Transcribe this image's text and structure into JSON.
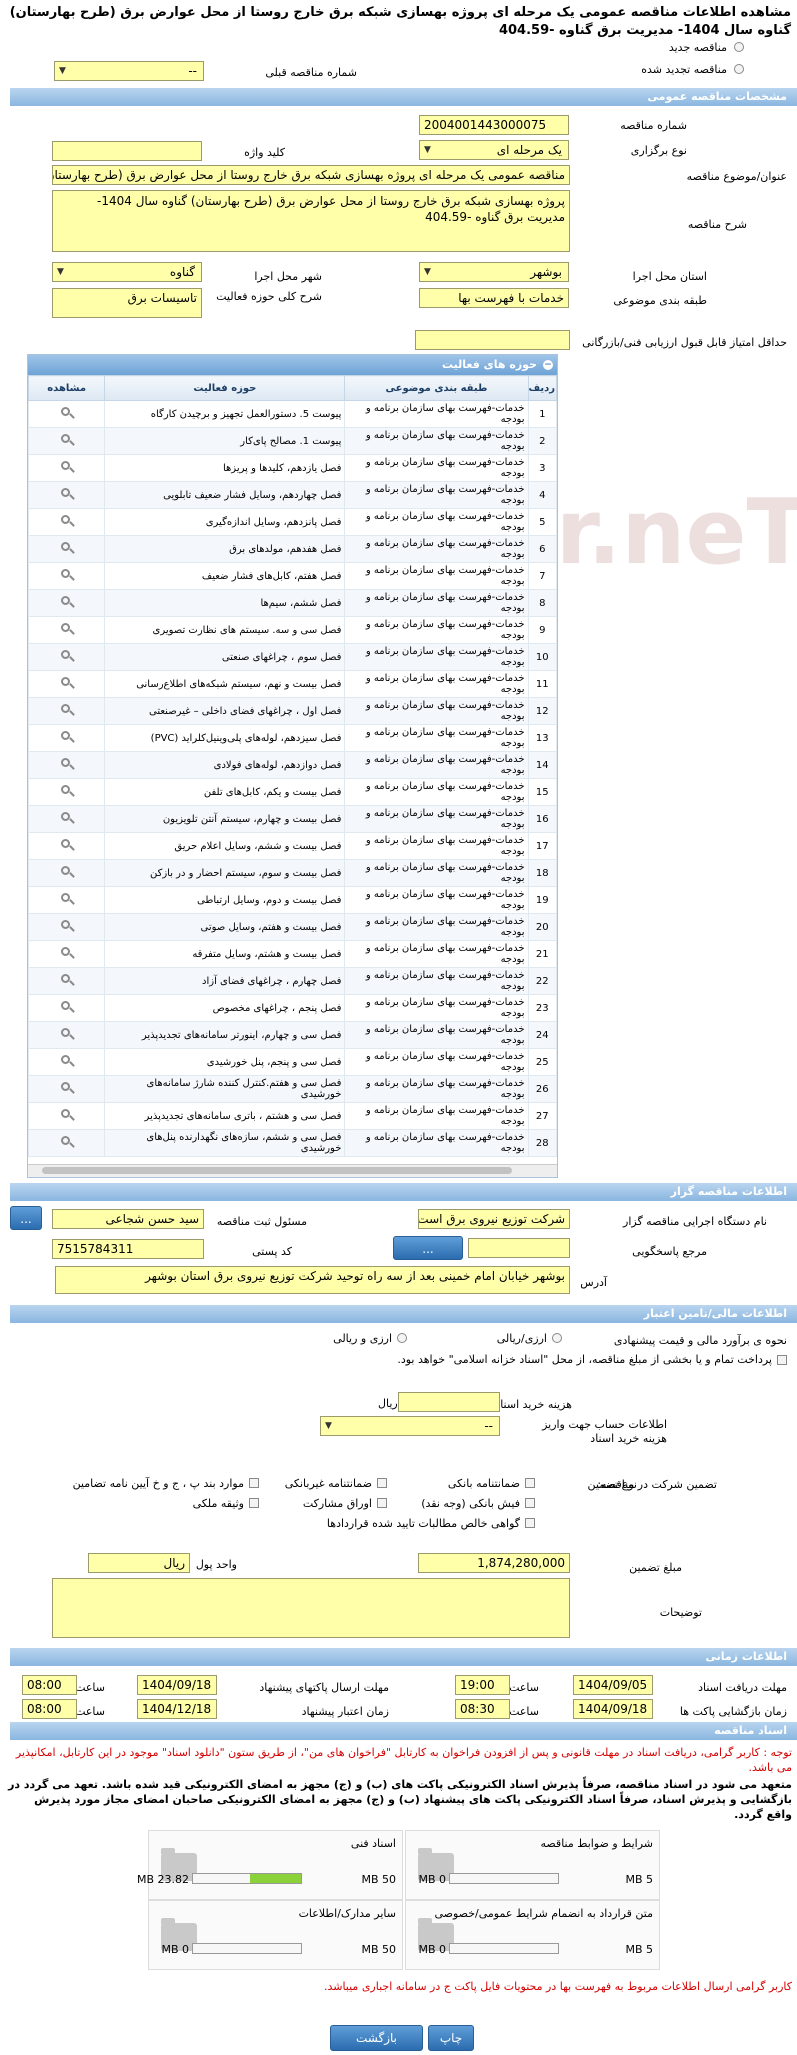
{
  "title": "مشاهده اطلاعات مناقصه عمومی یک مرحله ای پروژه بهسازی شبکه برق خارج روستا از محل عوارض برق (طرح بهارستان) گناوه سال 1404- مدیریت برق گناوه -404.59",
  "top": {
    "radio_new": "مناقصه جدید",
    "radio_renew": "مناقصه تجدید شده",
    "prev_number_label": "شماره مناقصه قبلی",
    "prev_number_value": "--"
  },
  "sections": {
    "general": "مشخصات مناقصه عمومی",
    "organizer": "اطلاعات مناقصه گزار",
    "financial": "اطلاعات مالی/تامین اعتبار",
    "timing": "اطلاعات زمانی",
    "documents": "اسناد مناقصه"
  },
  "general": {
    "number_label": "شماره مناقصه",
    "number_value": "2004001443000075",
    "type_label": "نوع برگزاری",
    "type_value": "یک مرحله ای",
    "keyword_label": "کلید واژه",
    "keyword_value": "",
    "subject_label": "عنوان/موضوع مناقصه",
    "subject_value": "مناقصه عمومی یک مرحله ای پروژه بهسازی شبکه برق خارج روستا از محل عوارض برق (طرح بهارستان)",
    "desc_label": "شرح مناقصه",
    "desc_value": "پروژه بهسازی شبکه برق خارج روستا از محل عوارض برق (طرح بهارستان) گناوه سال 1404- مدیریت برق گناوه -404.59",
    "province_label": "استان محل اجرا",
    "province_value": "بوشهر",
    "city_label": "شهر محل اجرا",
    "city_value": "گناوه",
    "category_label": "طبقه بندی موضوعی",
    "category_value": "خدمات با فهرست بها",
    "activity_label": "شرح کلی حوزه فعالیت",
    "activity_value": "تاسیسات برق",
    "min_score_label": "حداقل امتیاز قابل قبول ارزیابی فنی/بازرگانی",
    "min_score_value": ""
  },
  "grid": {
    "title": "حوزه های فعالیت",
    "columns": [
      "ردیف",
      "طبقه بندی موضوعی",
      "حوزه فعالیت",
      "مشاهده"
    ],
    "category": "خدمات-فهرست بهای سازمان برنامه و بودجه",
    "rows": [
      "پیوست 5. دستورالعمل تجهیز و برچیدن کارگاه",
      "پیوست 1. مصالح پای‌کار",
      "فصل یازدهم، کلیدها و پریزها",
      "فصل چهاردهم، وسایل فشار ضعیف تابلویی",
      "فصل پانزدهم، وسایل اندازه‌گیری",
      "فصل هفدهم، مولدهای برق",
      "فصل هفتم، کابل‌های فشار ضعیف",
      "فصل ششم، سیم‌ها",
      "فصل سی و سه. سیستم های نظارت تصویری",
      "فصل سوم ، چراغهای صنعتی",
      "فصل بیست و نهم، سیستم شبکه‌های اطلاع‌رسانی",
      "فصل اول ، چراغهای فضای داخلی – غیرصنعتی",
      "فصل سیزدهم، لوله‌های پلی‌وینیل‌کلراید (PVC)",
      "فصل دوازدهم، لوله‌های فولادی",
      "فصل بیست و یکم، کابل‌های تلفن",
      "فصل بیست و چهارم، سیستم آنتن تلویزیون",
      "فصل بیست و ششم، وسایل اعلام حریق",
      "فصل بیست و سوم، سیستم احضار و در بازکن",
      "فصل بیست و دوم، وسایل ارتباطی",
      "فصل بیست و هفتم، وسایل صوتی",
      "فصل بیست و هشتم، وسایل متفرقه",
      "فصل چهارم ، چراغهای فضای آزاد",
      "فصل پنجم ، چراغهای مخصوص",
      "فصل سی و چهارم، اینورتر سامانه‌های تجدیدپذیر",
      "فصل سی و پنجم، پنل خورشیدی",
      "فصل سی و هفتم.کنترل کننده شارژ سامانه‌های خورشیدی",
      "فصل سی و هشتم ، باتری سامانه‌های تجدیدپذیر",
      "فصل سی و ششم، سازه‌های نگهدارنده پنل‌های خورشیدی"
    ]
  },
  "organizer": {
    "device_label": "نام دستگاه اجرایی مناقصه گزار",
    "device_value": "شرکت توزیع نیروی برق است",
    "responsible_label": "مسئول ثبت مناقصه",
    "responsible_value": "سید حسن شجاعی",
    "ref_label": "مرجع پاسخگویی",
    "ref_value": "",
    "postal_label": "کد پستی",
    "postal_value": "7515784311",
    "address_label": "آدرس",
    "address_value": "بوشهر خیابان امام خمینی بعد از سه راه توحید شرکت توزیع نیروی برق استان بوشهر",
    "dots": "..."
  },
  "financial": {
    "estimate_label": "نحوه ی برآورد مالی و قیمت پیشنهادی",
    "opt_rial_currency": "ارزی/ریالی",
    "opt_currency_rial": "ارزی و ریالی",
    "islamic_label": "پرداخت تمام و یا بخشی از مبلغ مناقصه، از محل \"اسناد خزانه اسلامی\" خواهد بود.",
    "fee_label": "هزینه خرید اسناد",
    "fee_value": "",
    "fee_unit": "ریال",
    "account_label": "اطلاعات حساب جهت واریز هزینه خرید اسناد",
    "account_value": "--",
    "guarantee_label": "تضمین شرکت در مناقصه:",
    "guarantee_type_label": "نوع تضمین",
    "g_bank": "ضمانتنامه بانکی",
    "g_nonbank": "ضمانتنامه غیربانکی",
    "g_items": "موارد بند پ ، ج و خ آیین نامه تضامین",
    "g_cheque": "فیش بانکی (وجه نقد)",
    "g_bonds": "اوراق مشارکت",
    "g_property": "وثیقه ملکی",
    "g_claims": "گواهی خالص مطالبات تایید شده قراردادها",
    "amount_label": "مبلغ تضمین",
    "amount_value": "1,874,280,000",
    "currency_label": "واحد پول",
    "currency_value": "ریال",
    "notes_label": "توضیحات",
    "notes_value": ""
  },
  "timing": {
    "receive_label": "مهلت دریافت اسناد",
    "receive_date": "1404/09/05",
    "receive_time": "19:00",
    "send_label": "مهلت ارسال پاکتهای پیشنهاد",
    "send_date": "1404/09/18",
    "send_time": "08:00",
    "open_label": "زمان بازگشایی پاکت ها",
    "open_date": "1404/09/18",
    "open_time": "08:30",
    "valid_label": "زمان اعتبار پیشنهاد",
    "valid_date": "1404/12/18",
    "valid_time": "08:00",
    "time_label": "ساعت"
  },
  "documents": {
    "notice_red": "توجه : کاربر گرامی، دریافت اسناد در مهلت قانونی و پس از افزودن فراخوان به کارتابل \"فراخوان های من\"، از طریق ستون \"دانلود اسناد\" موجود در این کارتابل، امکانپذیر می باشد.",
    "notice_bold": "متعهد می شود در اسناد مناقصه، صرفاً پذیرش اسناد الکترونیکی پاکت های (ب) و (ج) مجهز به امضای الکترونیکی قید شده باشد. تعهد می گردد در بازگشایی و پذیرش اسناد، صرفاً اسناد الکترونیکی پاکت های پیشنهاد (ب) و (ج) مجهز به امضای الکترونیکی صاحبان امضای مجاز مورد پذیرش واقع گردد.",
    "boxes": [
      {
        "title": "شرایط و ضوابط مناقصه",
        "used": "0 MB",
        "max": "5 MB",
        "fill": 0
      },
      {
        "title": "اسناد فنی",
        "used": "23.82 MB",
        "max": "50 MB",
        "fill": 0.476
      },
      {
        "title": "متن قرارداد به انضمام شرایط عمومی/خصوصی",
        "used": "0 MB",
        "max": "5 MB",
        "fill": 0
      },
      {
        "title": "سایر مدارک/اطلاعات",
        "used": "0 MB",
        "max": "50 MB",
        "fill": 0
      }
    ],
    "footer_red": "کاربر گرامی ارسال اطلاعات مربوط به فهرست بها در محتویات فایل پاکت ج در سامانه اجباری میباشد."
  },
  "buttons": {
    "back": "بازگشت",
    "print": "چاپ"
  }
}
